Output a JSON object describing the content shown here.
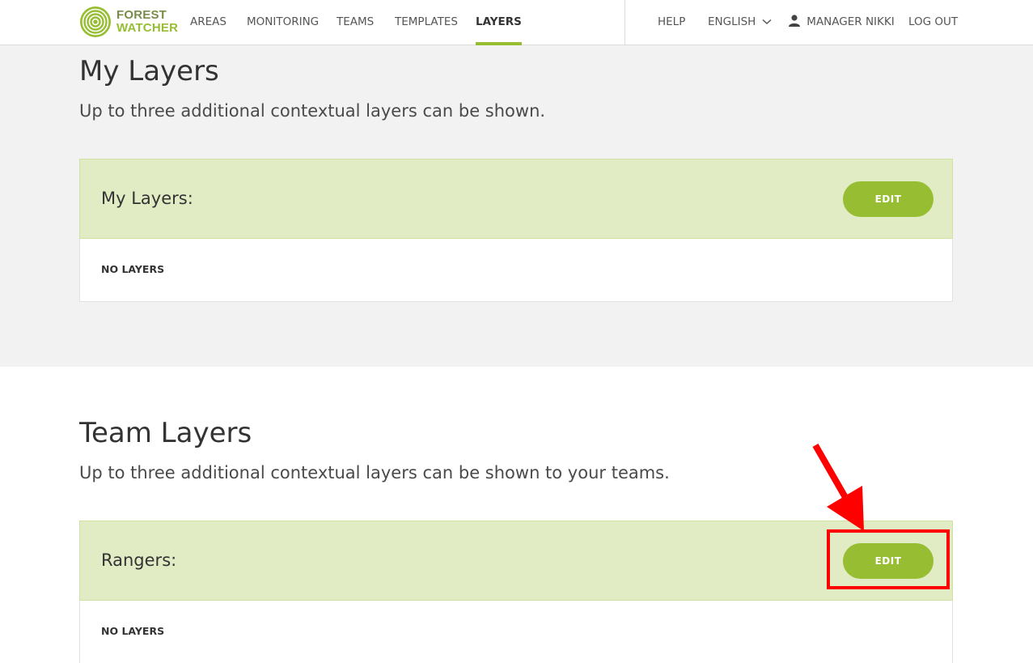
{
  "header": {
    "logo_line1": "FOREST",
    "logo_line2": "WATCHER",
    "nav": [
      {
        "label": "AREAS"
      },
      {
        "label": "MONITORING"
      },
      {
        "label": "TEAMS"
      },
      {
        "label": "TEMPLATES"
      },
      {
        "label": "LAYERS",
        "active": true
      }
    ],
    "help": "HELP",
    "language": "ENGLISH",
    "user": "MANAGER NIKKI",
    "logout": "LOG OUT"
  },
  "my_layers": {
    "title": "My Layers",
    "subtitle": "Up to three additional contextual layers can be shown.",
    "card_label": "My Layers:",
    "edit_label": "EDIT",
    "empty_text": "NO LAYERS"
  },
  "team_layers": {
    "title": "Team Layers",
    "subtitle": "Up to three additional contextual layers can be shown to your teams.",
    "card_label": "Rangers:",
    "edit_label": "EDIT",
    "empty_text": "NO LAYERS"
  },
  "colors": {
    "accent": "#97be32",
    "card_header_bg": "#e1ecc5",
    "gray_section_bg": "#f2f2f2",
    "annotation": "#ff0000"
  },
  "icons": [
    "forest-watcher-logo-icon",
    "chevron-down-icon",
    "user-icon",
    "annotation-arrow-icon"
  ]
}
